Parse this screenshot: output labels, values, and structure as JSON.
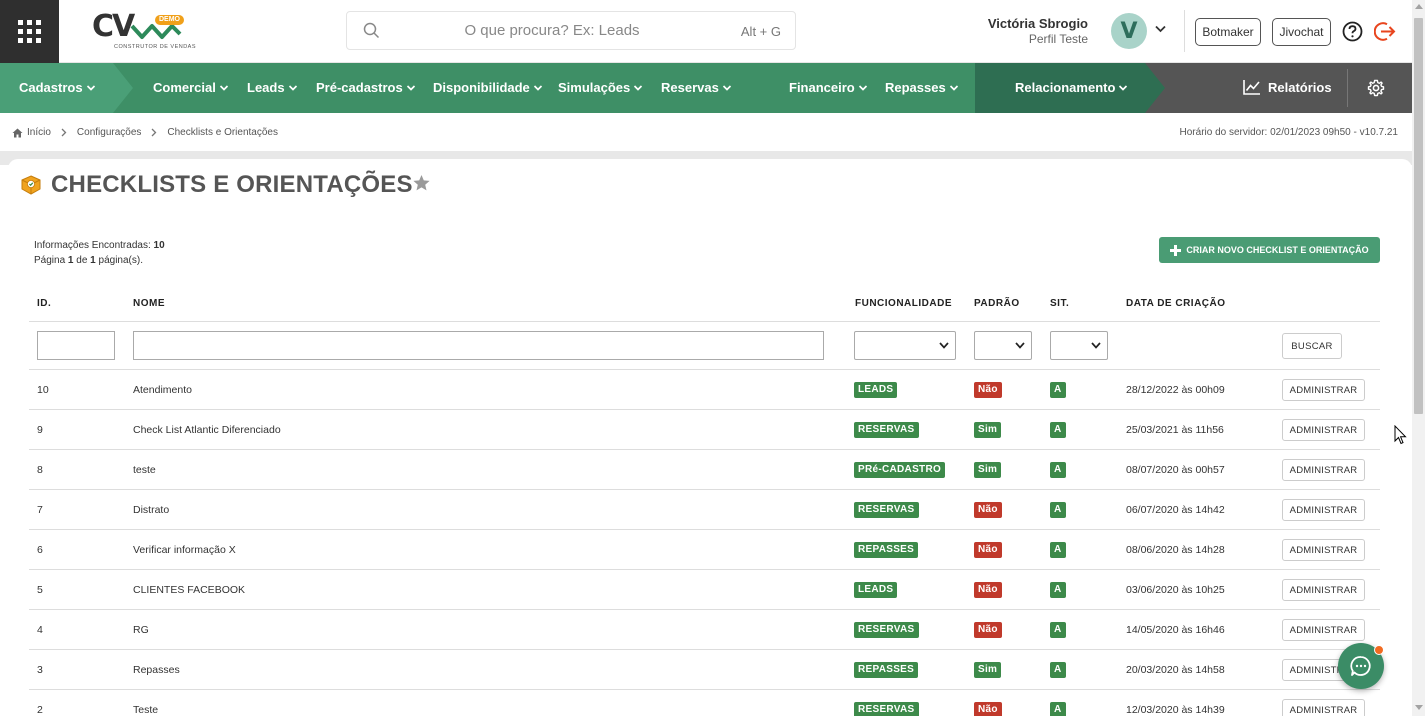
{
  "header": {
    "logo_text": "CV",
    "logo_badge": "DEMO",
    "logo_subtitle": "CONSTRUTOR DE VENDAS",
    "search_placeholder": "O que procura? Ex: Leads",
    "search_shortcut": "Alt + G",
    "user_name": "Victória Sbrogio",
    "user_profile": "Perfil Teste",
    "avatar_letter": "V",
    "botmaker_label": "Botmaker",
    "jivochat_label": "Jivochat"
  },
  "nav": {
    "items": [
      {
        "label": "Cadastros"
      },
      {
        "label": "Comercial"
      },
      {
        "label": "Leads"
      },
      {
        "label": "Pré-cadastros"
      },
      {
        "label": "Disponibilidade"
      },
      {
        "label": "Simulações"
      },
      {
        "label": "Reservas"
      },
      {
        "label": "Financeiro"
      },
      {
        "label": "Repasses"
      },
      {
        "label": "Relacionamento"
      }
    ],
    "reports_label": "Relatórios"
  },
  "breadcrumb": {
    "home": "Início",
    "level1": "Configurações",
    "level2": "Checklists e Orientações",
    "server_time": "Horário do servidor: 02/01/2023 09h50 - v10.7.21"
  },
  "page": {
    "title": "CHECKLISTS E ORIENTAÇÕES",
    "info_found_label": "Informações Encontradas:",
    "info_found_count": "10",
    "page_label": "Página",
    "page_current": "1",
    "page_of": "de",
    "page_total": "1",
    "page_suffix": "página(s).",
    "create_button": "CRIAR NOVO CHECKLIST E ORIENTAÇÃO"
  },
  "table": {
    "columns": {
      "id": "ID.",
      "name": "NOME",
      "feature": "FUNCIONALIDADE",
      "default": "PADRÃO",
      "status": "SIT.",
      "created": "DATA DE CRIAÇÃO"
    },
    "search_button": "BUSCAR",
    "admin_button": "ADMINISTRAR",
    "rows": [
      {
        "id": "10",
        "name": "Atendimento",
        "feature": "LEADS",
        "default": "Não",
        "status": "A",
        "created": "28/12/2022 às 00h09"
      },
      {
        "id": "9",
        "name": "Check List Atlantic Diferenciado",
        "feature": "RESERVAS",
        "default": "Sim",
        "status": "A",
        "created": "25/03/2021 às 11h56"
      },
      {
        "id": "8",
        "name": "teste",
        "feature": "PRé-CADASTRO",
        "default": "Sim",
        "status": "A",
        "created": "08/07/2020 às 00h57"
      },
      {
        "id": "7",
        "name": "Distrato",
        "feature": "RESERVAS",
        "default": "Não",
        "status": "A",
        "created": "06/07/2020 às 14h42"
      },
      {
        "id": "6",
        "name": "Verificar informação X",
        "feature": "REPASSES",
        "default": "Não",
        "status": "A",
        "created": "08/06/2020 às 14h28"
      },
      {
        "id": "5",
        "name": "CLIENTES FACEBOOK",
        "feature": "LEADS",
        "default": "Não",
        "status": "A",
        "created": "03/06/2020 às 10h25"
      },
      {
        "id": "4",
        "name": "RG",
        "feature": "RESERVAS",
        "default": "Não",
        "status": "A",
        "created": "14/05/2020 às 16h46"
      },
      {
        "id": "3",
        "name": "Repasses",
        "feature": "REPASSES",
        "default": "Sim",
        "status": "A",
        "created": "20/03/2020 às 14h58"
      },
      {
        "id": "2",
        "name": "Teste",
        "feature": "RESERVAS",
        "default": "Não",
        "status": "A",
        "created": "12/03/2020 às 14h39"
      }
    ]
  },
  "colors": {
    "badge_green": "#3d8a4a",
    "badge_red": "#c0392b",
    "nav_green": "#3e8f66",
    "accent": "#4a9c74"
  }
}
